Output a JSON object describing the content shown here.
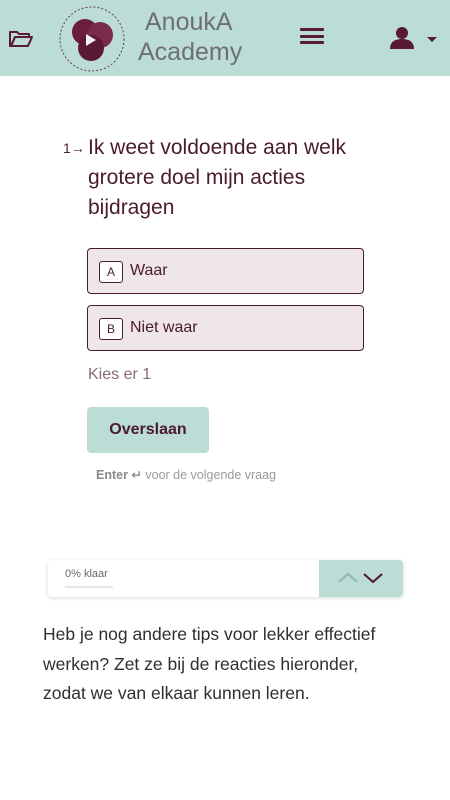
{
  "header": {
    "brand_line1": "AnoukA",
    "brand_line2": "Academy",
    "icons": {
      "folder": "folder-open-icon",
      "menu": "hamburger-menu-icon",
      "user": "user-icon",
      "caret": "caret-down-icon"
    },
    "colors": {
      "background": "#bcdcd6",
      "accent": "#5a1a33"
    }
  },
  "question": {
    "number": "1→",
    "text": "Ik weet voldoende aan welk grotere doel mijn acties bijdragen",
    "options": [
      {
        "key": "A",
        "label": "Waar"
      },
      {
        "key": "B",
        "label": "Niet waar"
      }
    ],
    "hint": "Kies er 1"
  },
  "actions": {
    "skip_label": "Overslaan",
    "enter_key": "Enter ↵",
    "enter_hint": "voor de volgende vraag"
  },
  "progress": {
    "label": "0% klaar",
    "percent": 0
  },
  "footer": {
    "text": "Heb je nog andere tips voor lekker effectief werken? Zet ze bij de reacties hieronder, zodat we van elkaar kunnen leren."
  }
}
